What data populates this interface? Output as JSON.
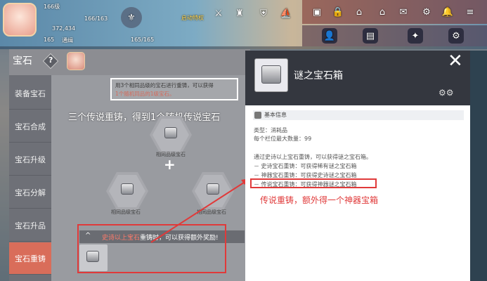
{
  "hud": {
    "level": "166级",
    "power_top": "166/163",
    "power_value": "372,434",
    "exp_left": "165",
    "map_name": "通缉",
    "coords": "165/165",
    "event_label": "启动特权"
  },
  "panel": {
    "title": "宝石",
    "help_symbol": "?"
  },
  "sidenav": {
    "items": [
      {
        "label": "装备宝石"
      },
      {
        "label": "宝石合成"
      },
      {
        "label": "宝石升级"
      },
      {
        "label": "宝石分解"
      },
      {
        "label": "宝石升品"
      },
      {
        "label": "宝石重铸"
      }
    ]
  },
  "content": {
    "hint_line1": "用3个相同品级的宝石进行重铸，可以获得",
    "hint_line2": "1个随机同品的1级宝石。",
    "caption": "三个传说重铸，得到1个随机传说宝石",
    "slot_label": "相同品级宝石",
    "plus": "+",
    "reward_prefix": "史诗以上宝石",
    "reward_suffix": "重铸时，可以获得额外奖励!",
    "reward_chevron": "^"
  },
  "item": {
    "name": "谜之宝石箱",
    "close": "✕",
    "section_title": "基本信息",
    "type_line": "类型：消耗品",
    "stack_line": "每个栏位最大数量：99",
    "desc_line": "通过史诗以上宝石重铸，可以获得谜之宝石箱。",
    "epic_line": "－ 史诗宝石重铸：可获得稀有谜之宝石箱",
    "artifact_line": "－ 神器宝石重铸：可获得史诗谜之宝石箱",
    "legend_line": "－ 传说宝石重铸：可获得神器谜之宝石箱",
    "caption": "传说重铸，额外得一个神器宝箱"
  },
  "colors": {
    "accent": "#d96d5a",
    "annotation_red": "#e03a3a",
    "panel_dark": "#34373f"
  }
}
